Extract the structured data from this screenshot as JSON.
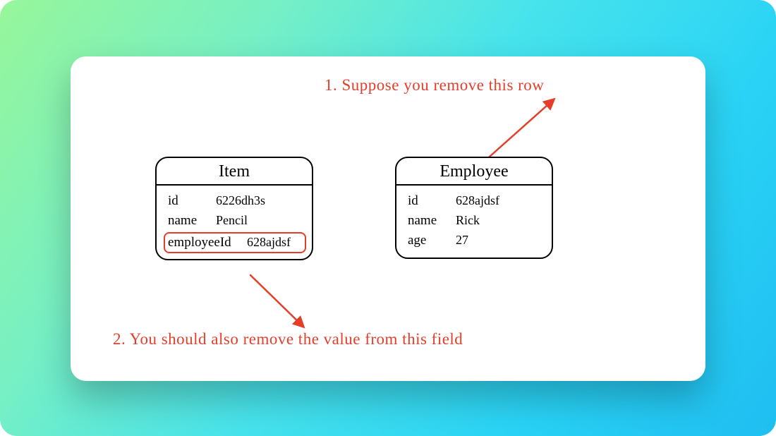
{
  "annotations": {
    "top": "1. Suppose you remove this row",
    "bottom": "2. You should also remove the value from this field"
  },
  "tables": {
    "item": {
      "title": "Item",
      "fields": {
        "id": {
          "key": "id",
          "value": "6226dh3s"
        },
        "name": {
          "key": "name",
          "value": "Pencil"
        },
        "emp": {
          "key": "employeeId",
          "value": "628ajdsf"
        }
      }
    },
    "employee": {
      "title": "Employee",
      "fields": {
        "id": {
          "key": "id",
          "value": "628ajdsf"
        },
        "name": {
          "key": "name",
          "value": "Rick"
        },
        "age": {
          "key": "age",
          "value": "27"
        }
      }
    }
  },
  "colors": {
    "annotation": "#e43e2b",
    "border": "#000000"
  }
}
